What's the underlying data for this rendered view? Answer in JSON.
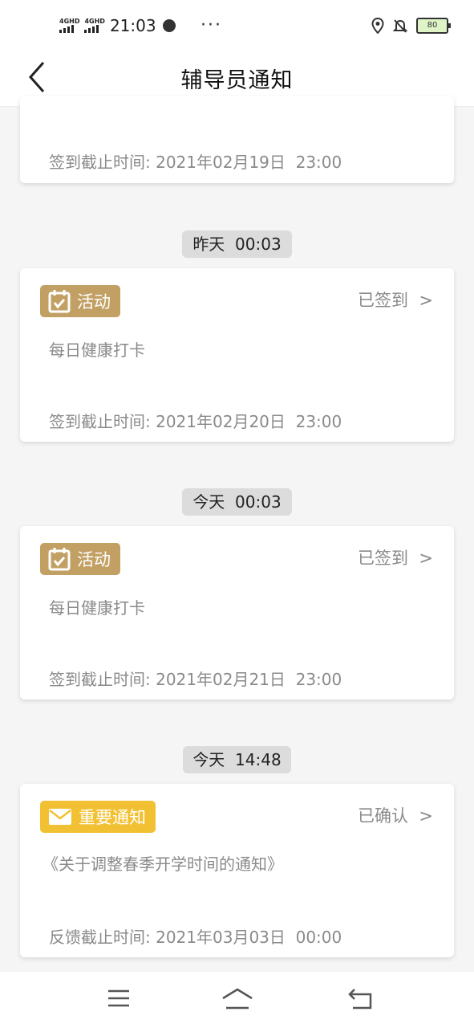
{
  "status_bar": {
    "network_1": "4GHD",
    "network_2": "4GHD",
    "time": "21:03",
    "more": "···",
    "battery": "80"
  },
  "header": {
    "title": "辅导员通知"
  },
  "top_card": {
    "deadline": "签到截止时间: 2021年02月19日  23:00"
  },
  "entries": [
    {
      "time": "昨天  00:03",
      "tag": "活动",
      "status": "已签到  >",
      "text": "每日健康打卡",
      "deadline": "签到截止时间: 2021年02月20日  23:00"
    },
    {
      "time": "今天  00:03",
      "tag": "活动",
      "status": "已签到  >",
      "text": "每日健康打卡",
      "deadline": "签到截止时间: 2021年02月21日  23:00"
    },
    {
      "time": "今天  14:48",
      "tag": "重要通知",
      "status": "已确认  >",
      "text": "《关于调整春季开学时间的通知》",
      "deadline": "反馈截止时间: 2021年03月03日  00:00"
    }
  ],
  "colors": {
    "activity_tag": "#c2a064",
    "important_tag": "#f2c133",
    "time_chip": "#dcdcdc",
    "page_bg": "#f5f5f5"
  }
}
